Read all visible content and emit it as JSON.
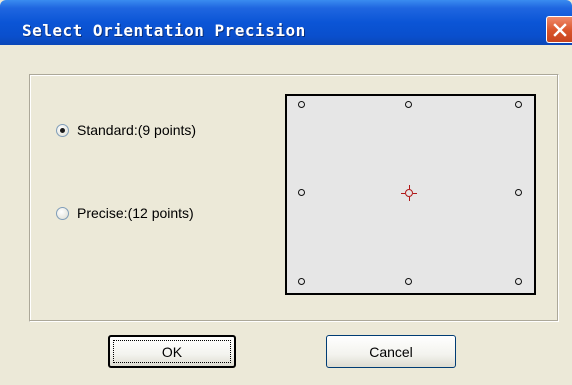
{
  "window": {
    "title": "Select Orientation Precision"
  },
  "options": [
    {
      "label": "Standard:(9 points)",
      "selected": true
    },
    {
      "label": "Precise:(12 points)",
      "selected": false
    }
  ],
  "preview": {
    "point_count": 9,
    "highlighted_point": "center"
  },
  "buttons": {
    "ok_label": "OK",
    "cancel_label": "Cancel"
  },
  "colors": {
    "titlebar": "#0a4fcd",
    "close_button": "#d9542a",
    "center_point": "#b01818",
    "preview_bg": "#e6e6e6"
  }
}
